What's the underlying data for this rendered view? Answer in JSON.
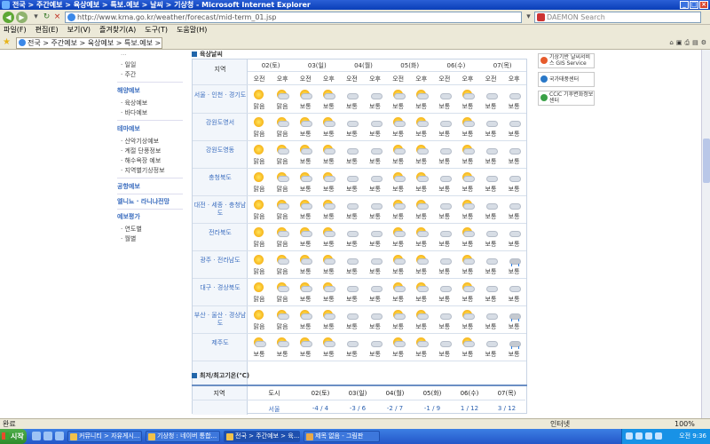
{
  "window": {
    "title": "전국 > 주간예보 > 육상예보 > 특보.예보 > 날씨 > 기상청 - Microsoft Internet Explorer",
    "address": "http://www.kma.go.kr/weather/forecast/mid-term_01.jsp",
    "search_placeholder": "DAEMON Search",
    "tab_title": "전국 > 주간예보 > 육상예보 > 특보.예보 > 날..."
  },
  "menu": [
    "파일(F)",
    "편집(E)",
    "보기(V)",
    "즐겨찾기(A)",
    "도구(T)",
    "도움말(H)"
  ],
  "left_menu": {
    "cut_label": "...",
    "items_top": [
      "· 일일",
      "· 주간"
    ],
    "section_marine": "해양예보",
    "marine_items": [
      "· 육상예보",
      "· 바다예보"
    ],
    "section_theme": "테마예보",
    "theme_items": [
      "· 산악기상예보",
      "· 계절 단풍정보",
      "· 해수욕장 예보",
      "· 지역별기상정보"
    ],
    "section_air": "공항예보",
    "section_nino": "엘니뇨 · 라니냐전망",
    "section_eval": "예보평가",
    "eval_items": [
      "· 연도별",
      "· 월별"
    ]
  },
  "forecast": {
    "section_title": "육상날씨",
    "region_header": "지역",
    "days": [
      "02(토)",
      "03(일)",
      "04(월)",
      "05(화)",
      "06(수)",
      "07(목)"
    ],
    "ampm": [
      "오전",
      "오후"
    ],
    "rows": [
      {
        "region": "서울 · 인천 · 경기도",
        "icons": [
          "sun",
          "suncloud",
          "suncloud",
          "suncloud",
          "cloud",
          "cloud",
          "suncloud",
          "suncloud",
          "cloud",
          "suncloud",
          "cloud",
          "cloud"
        ],
        "text": [
          "맑음",
          "맑음",
          "보통",
          "보통",
          "보통",
          "보통",
          "보통",
          "보통",
          "보통",
          "보통",
          "보통",
          "보통"
        ]
      },
      {
        "region": "강원도영서",
        "icons": [
          "sun",
          "suncloud",
          "suncloud",
          "suncloud",
          "cloud",
          "cloud",
          "suncloud",
          "suncloud",
          "cloud",
          "suncloud",
          "cloud",
          "cloud"
        ],
        "text": [
          "맑음",
          "맑음",
          "보통",
          "보통",
          "보통",
          "보통",
          "보통",
          "보통",
          "보통",
          "보통",
          "보통",
          "보통"
        ]
      },
      {
        "region": "강원도영동",
        "icons": [
          "sun",
          "suncloud",
          "suncloud",
          "suncloud",
          "cloud",
          "cloud",
          "suncloud",
          "suncloud",
          "cloud",
          "suncloud",
          "cloud",
          "cloud"
        ],
        "text": [
          "맑음",
          "맑음",
          "보통",
          "보통",
          "보통",
          "보통",
          "보통",
          "보통",
          "보통",
          "보통",
          "보통",
          "보통"
        ]
      },
      {
        "region": "충청북도",
        "icons": [
          "sun",
          "suncloud",
          "suncloud",
          "suncloud",
          "cloud",
          "cloud",
          "suncloud",
          "suncloud",
          "cloud",
          "suncloud",
          "cloud",
          "cloud"
        ],
        "text": [
          "맑음",
          "맑음",
          "보통",
          "보통",
          "보통",
          "보통",
          "보통",
          "보통",
          "보통",
          "보통",
          "보통",
          "보통"
        ]
      },
      {
        "region": "대전 · 세종 · 충청남도",
        "icons": [
          "sun",
          "suncloud",
          "suncloud",
          "suncloud",
          "cloud",
          "cloud",
          "suncloud",
          "suncloud",
          "cloud",
          "suncloud",
          "cloud",
          "cloud"
        ],
        "text": [
          "맑음",
          "맑음",
          "보통",
          "보통",
          "보통",
          "보통",
          "보통",
          "보통",
          "보통",
          "보통",
          "보통",
          "보통"
        ]
      },
      {
        "region": "전라북도",
        "icons": [
          "sun",
          "suncloud",
          "suncloud",
          "suncloud",
          "cloud",
          "cloud",
          "suncloud",
          "suncloud",
          "cloud",
          "suncloud",
          "cloud",
          "cloud"
        ],
        "text": [
          "맑음",
          "맑음",
          "보통",
          "보통",
          "보통",
          "보통",
          "보통",
          "보통",
          "보통",
          "보통",
          "보통",
          "보통"
        ]
      },
      {
        "region": "광주 · 전라남도",
        "icons": [
          "sun",
          "suncloud",
          "suncloud",
          "suncloud",
          "cloud",
          "cloud",
          "suncloud",
          "suncloud",
          "cloud",
          "suncloud",
          "cloud",
          "rain"
        ],
        "text": [
          "맑음",
          "맑음",
          "보통",
          "보통",
          "보통",
          "보통",
          "보통",
          "보통",
          "보통",
          "보통",
          "보통",
          "보통"
        ]
      },
      {
        "region": "대구 · 경상북도",
        "icons": [
          "sun",
          "suncloud",
          "suncloud",
          "suncloud",
          "cloud",
          "cloud",
          "suncloud",
          "suncloud",
          "cloud",
          "suncloud",
          "cloud",
          "cloud"
        ],
        "text": [
          "맑음",
          "맑음",
          "보통",
          "보통",
          "보통",
          "보통",
          "보통",
          "보통",
          "보통",
          "보통",
          "보통",
          "보통"
        ]
      },
      {
        "region": "부산 · 울산 · 경상남도",
        "icons": [
          "sun",
          "suncloud",
          "suncloud",
          "suncloud",
          "cloud",
          "cloud",
          "suncloud",
          "suncloud",
          "cloud",
          "suncloud",
          "cloud",
          "rain"
        ],
        "text": [
          "맑음",
          "맑음",
          "보통",
          "보통",
          "보통",
          "보통",
          "보통",
          "보통",
          "보통",
          "보통",
          "보통",
          "보통"
        ]
      },
      {
        "region": "제주도",
        "icons": [
          "suncloud",
          "suncloud",
          "suncloud",
          "suncloud",
          "cloud",
          "cloud",
          "suncloud",
          "suncloud",
          "cloud",
          "suncloud",
          "cloud",
          "rain"
        ],
        "text": [
          "보통",
          "보통",
          "보통",
          "보통",
          "보통",
          "보통",
          "보통",
          "보통",
          "보통",
          "보통",
          "보통",
          "보통"
        ]
      }
    ]
  },
  "minmax": {
    "title": "최저/최고기온(℃)",
    "header": [
      "지역",
      "도시",
      "02(토)",
      "03(일)",
      "04(월)",
      "05(화)",
      "06(수)",
      "07(목)"
    ],
    "rows": [
      {
        "city": "서울",
        "temps": [
          "-4 / 4",
          "-3 / 6",
          "-2 / 7",
          "-1 / 9",
          "1 / 12",
          "3 / 12"
        ]
      }
    ]
  },
  "banners": [
    "기상기반 날씨서비스 GIS Service",
    "국가태풍센터",
    "CCiC 기후변화정보센터"
  ],
  "status": {
    "left": "완료",
    "zone": "인터넷",
    "zoom": "100%"
  },
  "taskbar": {
    "start": "시작",
    "items": [
      "커뮤니티 > 자유게시...",
      "기상청 : 네이버 통합...",
      "전국 > 주간예보 > 육...",
      "제목 없음 - 그림판"
    ],
    "clock": "오전 9:36"
  },
  "colors": {
    "link_blue": "#3c6ebf",
    "table_border": "#c8d4e4",
    "taskbar": "#2456c8"
  }
}
